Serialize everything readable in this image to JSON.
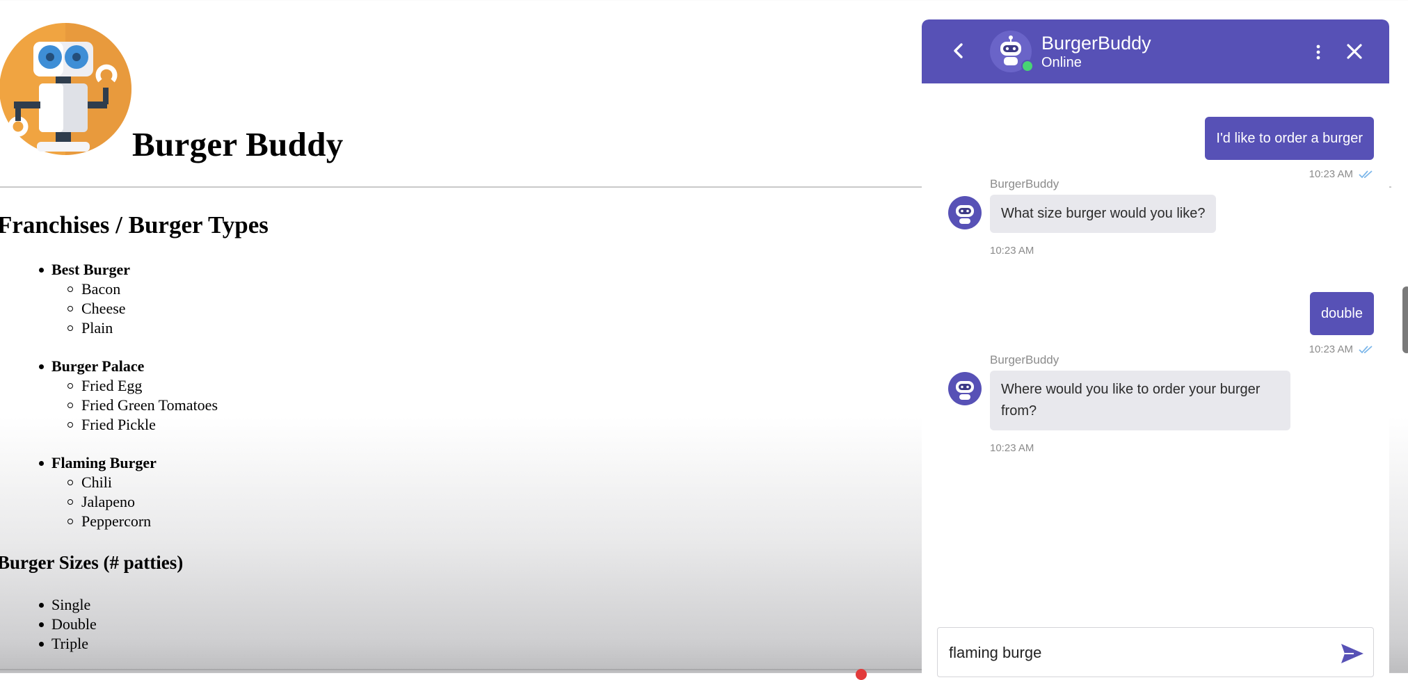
{
  "site": {
    "title": "Burger Buddy",
    "franchises_heading": "Franchises / Burger Types",
    "franchises": [
      {
        "name": "Best Burger",
        "types": [
          "Bacon",
          "Cheese",
          "Plain"
        ]
      },
      {
        "name": "Burger Palace",
        "types": [
          "Fried Egg",
          "Fried Green Tomatoes",
          "Fried Pickle"
        ]
      },
      {
        "name": "Flaming Burger",
        "types": [
          "Chili",
          "Jalapeno",
          "Peppercorn"
        ]
      }
    ],
    "sizes_heading": "Burger Sizes (# patties)",
    "sizes": [
      "Single",
      "Double",
      "Triple"
    ],
    "logo_icon": "robot-logo"
  },
  "chat": {
    "header": {
      "bot_name": "BurgerBuddy",
      "status": "Online",
      "icons": {
        "back": "chevron-left-icon",
        "menu": "kebab-menu-icon",
        "close": "close-icon"
      }
    },
    "messages": [
      {
        "from": "user",
        "text": "I'd like to order a burger",
        "time": "10:23 AM"
      },
      {
        "from": "bot",
        "sender": "BurgerBuddy",
        "text": "What size burger would you like?",
        "time": "10:23 AM"
      },
      {
        "from": "user",
        "text": "double",
        "time": "10:23 AM"
      },
      {
        "from": "bot",
        "sender": "BurgerBuddy",
        "text": "Where would you like to order your burger from?",
        "time": "10:23 AM"
      }
    ],
    "input_value": "flaming burge",
    "send_icon": "send-icon"
  },
  "colors": {
    "accent": "#5751b6",
    "bot_bubble": "#e8e8ed",
    "online": "#48d474",
    "read_tick": "#7db7ea",
    "logo_orange": "#f0a441"
  }
}
